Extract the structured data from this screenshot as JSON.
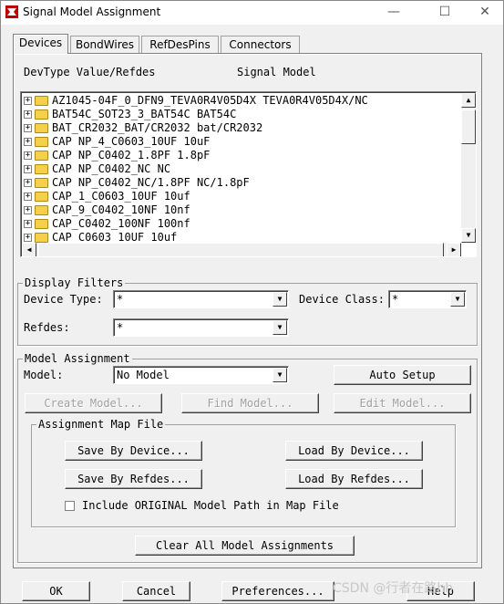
{
  "window": {
    "title": "Signal Model Assignment",
    "minimize": "—",
    "maximize": "☐",
    "close": "✕"
  },
  "tabs": [
    "Devices",
    "BondWires",
    "RefDesPins",
    "Connectors"
  ],
  "list_header": {
    "col1": "DevType Value/Refdes",
    "col2": "Signal Model"
  },
  "tree_rows": [
    "AZ1045-04F_0_DFN9_TEVA0R4V05D4X TEVA0R4V05D4X/NC",
    "BAT54C_SOT23_3_BAT54C BAT54C",
    "BAT_CR2032_BAT/CR2032 bat/CR2032",
    "CAP NP_4_C0603_10UF 10uF",
    "CAP NP_C0402_1.8PF 1.8pF",
    "CAP NP_C0402_NC NC",
    "CAP NP_C0402_NC/1.8PF NC/1.8pF",
    "CAP_1_C0603_10UF 10uf",
    "CAP_9_C0402_10NF 10nf",
    "CAP_C0402_100NF 100nf",
    "CAP_C0603_10UF 10uf"
  ],
  "display_filters": {
    "title": "Display Filters",
    "device_type_label": "Device Type:",
    "device_type_value": "*",
    "device_class_label": "Device Class:",
    "device_class_value": "*",
    "refdes_label": "Refdes:",
    "refdes_value": "*"
  },
  "model_assignment": {
    "title": "Model Assignment",
    "model_label": "Model:",
    "model_value": "No Model",
    "auto_setup": "Auto Setup",
    "create_model": "Create Model...",
    "find_model": "Find Model...",
    "edit_model": "Edit Model..."
  },
  "map_file": {
    "title": "Assignment Map File",
    "save_by_device": "Save By Device...",
    "load_by_device": "Load By Device...",
    "save_by_refdes": "Save By Refdes...",
    "load_by_refdes": "Load By Refdes...",
    "include_original": "Include ORIGINAL Model Path in Map File"
  },
  "clear_all": "Clear All Model Assignments",
  "footer": {
    "ok": "OK",
    "cancel": "Cancel",
    "preferences": "Preferences...",
    "help": "Help"
  },
  "watermark": "CSDN @行者在路hh"
}
